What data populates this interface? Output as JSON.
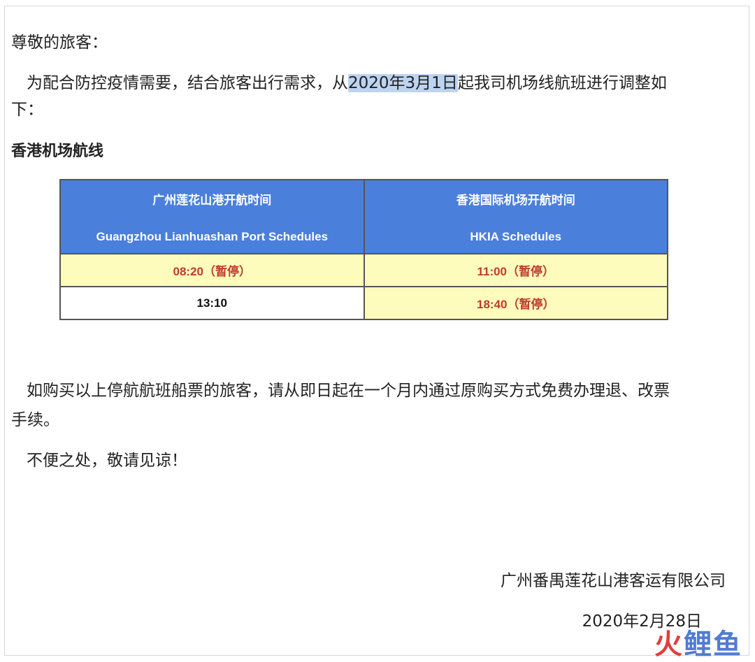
{
  "notice": {
    "greeting": "尊敬的旅客：",
    "para1_pre": "为配合防控疫情需要，结合旅客出行需求，从",
    "para1_highlight": "2020年3月1日",
    "para1_post": "起我司机场线航班进行调整如",
    "para1_cont": "下：",
    "section_title": "香港机场航线",
    "para2_line1": "如购买以上停航航班船票的旅客，请从即日起在一个月内通过原购买方式免费办理退、改票",
    "para2_line2": "手续。",
    "para3": "不便之处，敬请见谅！",
    "company": "广州番禺莲花山港客运有限公司",
    "date": "2020年2月28日"
  },
  "schedule": {
    "headers": [
      {
        "cn": "广州莲花山港开航时间",
        "en": "Guangzhou Lianhuashan Port Schedules"
      },
      {
        "cn": "香港国际机场开航时间",
        "en": "HKIA  Schedules"
      }
    ],
    "rows": [
      [
        "08:20（暂停）",
        "11:00（暂停）"
      ],
      [
        "13:10",
        "18:40（暂停）"
      ]
    ]
  },
  "watermark": {
    "part1": "火",
    "part2": "鲤鱼"
  },
  "colors": {
    "header_bg": "#4a7fdc",
    "suspended_bg": "#fdfcbd",
    "suspended_text": "#c0392b",
    "highlight": "#bcd4f2"
  }
}
